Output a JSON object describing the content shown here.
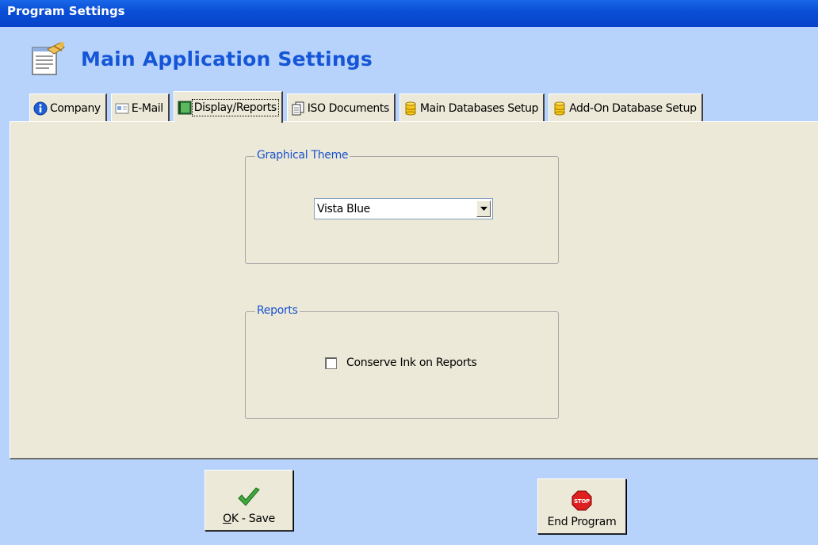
{
  "window": {
    "title": "Program Settings"
  },
  "header": {
    "title": "Main Application Settings",
    "icon": "settings-document-icon"
  },
  "tabs": [
    {
      "label": "Company",
      "icon": "info-icon"
    },
    {
      "label": "E-Mail",
      "icon": "email-card-icon"
    },
    {
      "label": "Display/Reports",
      "icon": "display-book-icon",
      "active": true
    },
    {
      "label": "ISO Documents",
      "icon": "documents-icon"
    },
    {
      "label": "Main Databases Setup",
      "icon": "database-icon"
    },
    {
      "label": "Add-On Database Setup",
      "icon": "database-icon"
    }
  ],
  "graphical_theme": {
    "legend": "Graphical Theme",
    "selected": "Vista Blue"
  },
  "reports": {
    "legend": "Reports",
    "conserve_ink_label": "Conserve Ink on Reports",
    "conserve_ink_checked": false
  },
  "buttons": {
    "ok_save": {
      "mnemonic": "O",
      "rest": "K - Save",
      "icon": "checkmark-icon"
    },
    "end_program": {
      "label": "End Program",
      "icon": "stop-sign-icon",
      "icon_text": "STOP"
    }
  },
  "colors": {
    "title_bar": "#0a4fd7",
    "header_title": "#1556d8",
    "group_legend": "#1a52cc",
    "window_bg": "#b7d3fb",
    "panel_bg": "#ece9d8"
  }
}
